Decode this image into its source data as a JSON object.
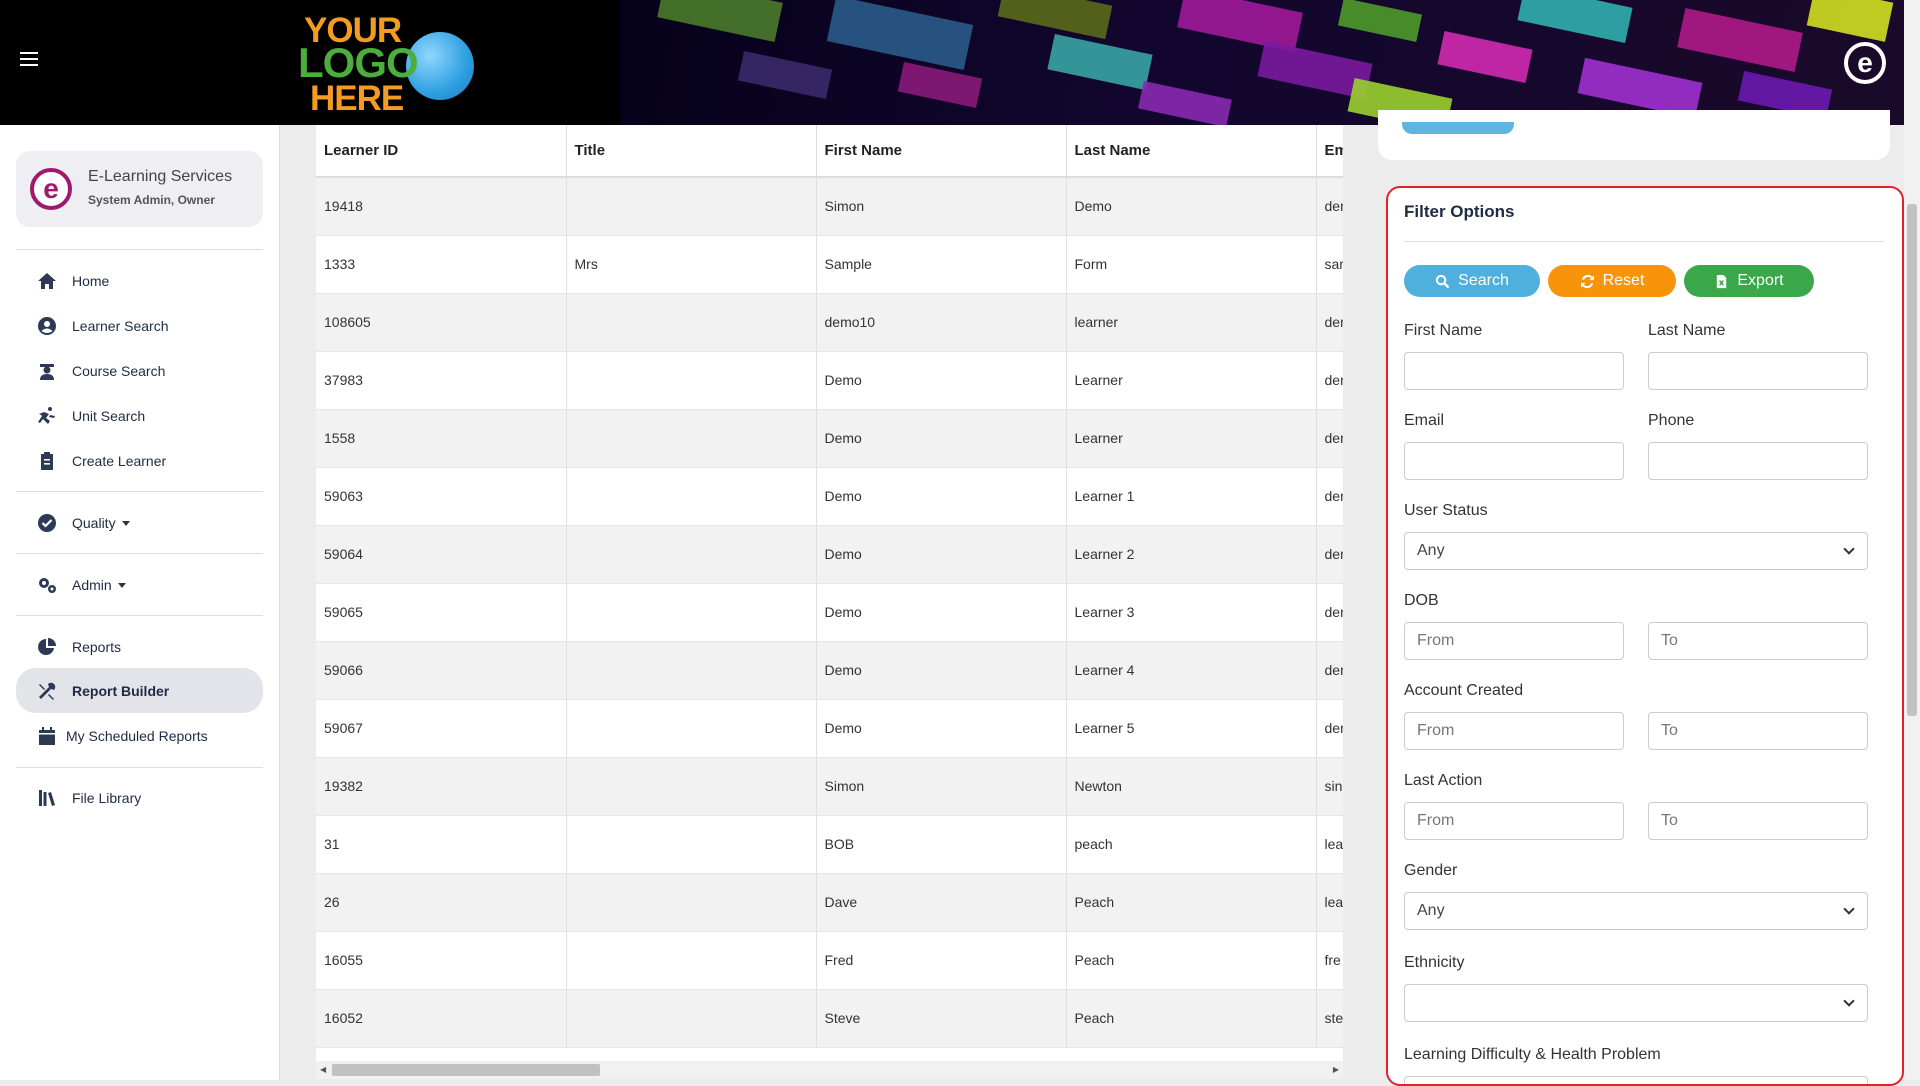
{
  "header": {
    "menu_icon": "hamburger-icon",
    "logo_lines": [
      "YOUR",
      "LOGO",
      "HERE"
    ],
    "brand_icon": "e"
  },
  "sidebar": {
    "profile": {
      "name": "E-Learning Services",
      "role": "System Admin, Owner",
      "avatar": "e"
    },
    "items": [
      {
        "label": "Home",
        "icon": "home-icon"
      },
      {
        "label": "Learner Search",
        "icon": "user-circle-icon"
      },
      {
        "label": "Course Search",
        "icon": "graduate-icon"
      },
      {
        "label": "Unit Search",
        "icon": "run-icon"
      },
      {
        "label": "Create Learner",
        "icon": "clipboard-icon"
      },
      {
        "label": "Quality",
        "icon": "check-circle-icon"
      },
      {
        "label": "Admin",
        "icon": "cogs-icon"
      },
      {
        "label": "Reports",
        "icon": "pie-chart-icon"
      },
      {
        "label": "Report Builder",
        "icon": "tools-icon"
      },
      {
        "label": "My Scheduled Reports",
        "icon": "calendar-icon"
      },
      {
        "label": "File Library",
        "icon": "library-icon"
      }
    ]
  },
  "table": {
    "columns": [
      "Learner ID",
      "Title",
      "First Name",
      "Last Name",
      "Em"
    ],
    "rows": [
      [
        "19418",
        "",
        "Simon",
        "Demo",
        "der"
      ],
      [
        "1333",
        "Mrs",
        "Sample",
        "Form",
        "sar"
      ],
      [
        "108605",
        "",
        "demo10",
        "learner",
        "der"
      ],
      [
        "37983",
        "",
        "Demo",
        "Learner",
        "der"
      ],
      [
        "1558",
        "",
        "Demo",
        "Learner",
        "der"
      ],
      [
        "59063",
        "",
        "Demo",
        "Learner 1",
        "der"
      ],
      [
        "59064",
        "",
        "Demo",
        "Learner 2",
        "der"
      ],
      [
        "59065",
        "",
        "Demo",
        "Learner 3",
        "der"
      ],
      [
        "59066",
        "",
        "Demo",
        "Learner 4",
        "der"
      ],
      [
        "59067",
        "",
        "Demo",
        "Learner 5",
        "der"
      ],
      [
        "19382",
        "",
        "Simon",
        "Newton",
        "sin"
      ],
      [
        "31",
        "",
        "BOB",
        "peach",
        "lea"
      ],
      [
        "26",
        "",
        "Dave",
        "Peach",
        "lea"
      ],
      [
        "16055",
        "",
        "Fred",
        "Peach",
        "fre"
      ],
      [
        "16052",
        "",
        "Steve",
        "Peach",
        "ste"
      ]
    ]
  },
  "filter": {
    "title": "Filter Options",
    "buttons": {
      "search": "Search",
      "reset": "Reset",
      "export": "Export"
    },
    "labels": {
      "first_name": "First Name",
      "last_name": "Last Name",
      "email": "Email",
      "phone": "Phone",
      "user_status": "User Status",
      "dob": "DOB",
      "account_created": "Account Created",
      "last_action": "Last Action",
      "gender": "Gender",
      "ethnicity": "Ethnicity",
      "ldhp": "Learning Difficulty & Health Problem"
    },
    "placeholders": {
      "from": "From",
      "to": "To"
    },
    "selects": {
      "user_status": "Any",
      "gender": "Any",
      "ethnicity": ""
    }
  },
  "colors": {
    "search": "#4fb0de",
    "reset": "#f7940a",
    "export": "#3aa74a",
    "highlight": "#e3212a",
    "brand": "#a0196e"
  }
}
